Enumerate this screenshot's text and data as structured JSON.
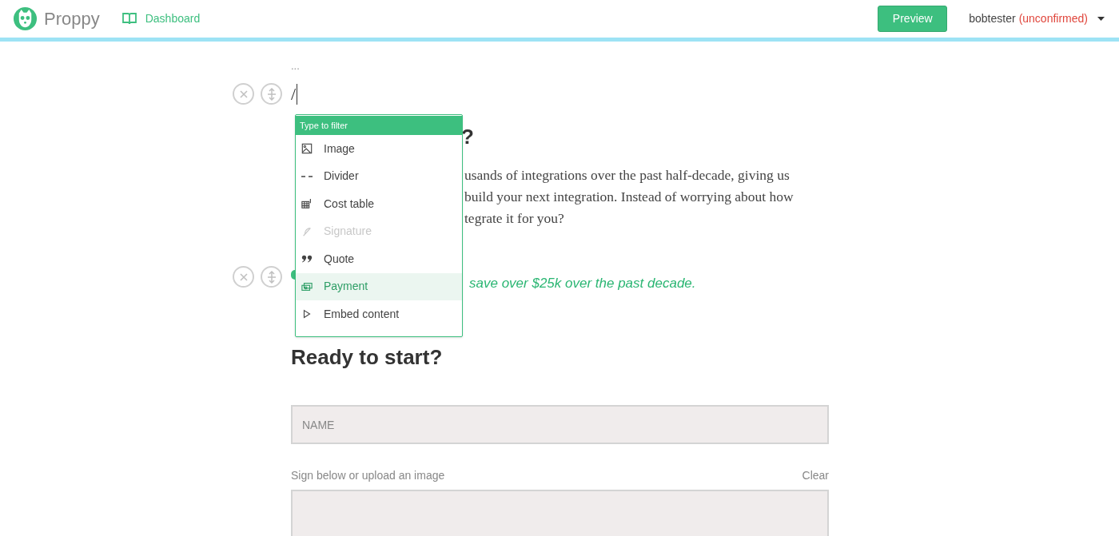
{
  "header": {
    "brand": "Proppy",
    "nav_link": "Dashboard",
    "preview_button": "Preview",
    "user": "bobtester",
    "user_status": "(unconfirmed)"
  },
  "editor": {
    "ellipsis": "...",
    "slash_input": "/",
    "heading_fragment": "?",
    "paragraph_fragments": [
      "usands of integrations over the past half-decade, giving us",
      "build your next integration. Instead of worrying about how",
      "tegrate it for you?"
    ],
    "quote_fragment": "save over $25k over the past decade.",
    "cta_heading": "Ready to start?",
    "name_field": {
      "placeholder": "NAME"
    },
    "signature_label": "Sign below or upload an image",
    "clear_link": "Clear"
  },
  "block_menu": {
    "filter_placeholder": "Type to filter",
    "items": [
      {
        "kind": "image",
        "label": "Image",
        "disabled": false,
        "selected": false
      },
      {
        "kind": "divider",
        "label": "Divider",
        "disabled": false,
        "selected": false
      },
      {
        "kind": "cost",
        "label": "Cost table",
        "disabled": false,
        "selected": false
      },
      {
        "kind": "signature",
        "label": "Signature",
        "disabled": true,
        "selected": false
      },
      {
        "kind": "quote",
        "label": "Quote",
        "disabled": false,
        "selected": false
      },
      {
        "kind": "payment",
        "label": "Payment",
        "disabled": false,
        "selected": true
      },
      {
        "kind": "embed",
        "label": "Embed content",
        "disabled": false,
        "selected": false
      }
    ]
  }
}
